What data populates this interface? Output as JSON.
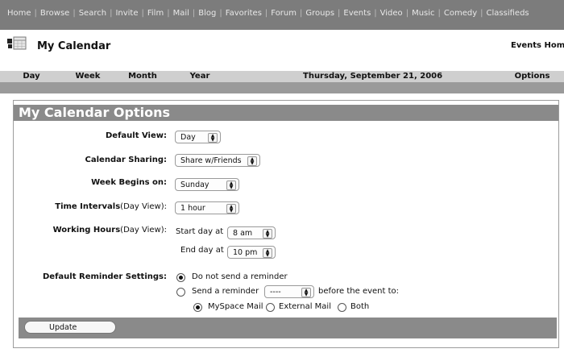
{
  "nav": {
    "items": [
      "Home",
      "Browse",
      "Search",
      "Invite",
      "Film",
      "Mail",
      "Blog",
      "Favorites",
      "Forum",
      "Groups",
      "Events",
      "Video",
      "Music",
      "Comedy",
      "Classifieds"
    ]
  },
  "header": {
    "title": "My Calendar",
    "events_home": "Events Home"
  },
  "tabs": {
    "day": "Day",
    "week": "Week",
    "month": "Month",
    "year": "Year",
    "date": "Thursday, September 21, 2006",
    "options": "Options"
  },
  "options": {
    "title": "My Calendar Options",
    "default_view": {
      "label": "Default View:",
      "value": "Day"
    },
    "calendar_sharing": {
      "label": "Calendar Sharing:",
      "value": "Share w/Friends"
    },
    "week_begins": {
      "label": "Week Begins on:",
      "value": "Sunday"
    },
    "time_intervals": {
      "label_bold": "Time Intervals",
      "label_rest": "(Day View):",
      "value": "1 hour"
    },
    "working_hours": {
      "label_bold": "Working Hours",
      "label_rest": "(Day View):",
      "start_label": "Start day at",
      "start_value": "8 am",
      "end_label": "End day at",
      "end_value": "10 pm"
    },
    "reminder": {
      "label": "Default Reminder Settings:",
      "no_reminder": "Do not send a reminder",
      "send_prefix": "Send a reminder",
      "send_value": "----",
      "send_suffix": "before the event to:",
      "myspace_mail": "MySpace Mail",
      "external_mail": "External Mail",
      "both": "Both"
    },
    "update_button": "Update"
  }
}
